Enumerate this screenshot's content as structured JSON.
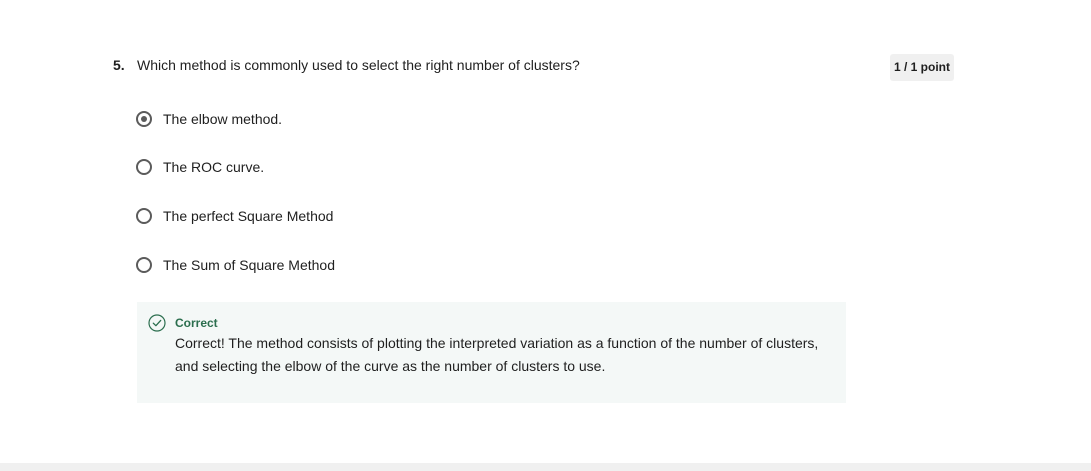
{
  "question": {
    "number": "5.",
    "text": "Which method is commonly used to select the right number of clusters?",
    "points": "1 / 1 point"
  },
  "options": [
    {
      "label": "The elbow method.",
      "selected": true
    },
    {
      "label": "The ROC curve.",
      "selected": false
    },
    {
      "label": "The perfect Square Method",
      "selected": false
    },
    {
      "label": "The Sum of Square Method",
      "selected": false
    }
  ],
  "feedback": {
    "status": "Correct",
    "text": "Correct! The method consists of plotting the interpreted variation as a function of the number of clusters, and selecting the elbow of the curve as the number of clusters to use.",
    "icon": "check-circle-icon",
    "status_color": "#2b6e4e",
    "background_color": "#f4f8f7"
  }
}
